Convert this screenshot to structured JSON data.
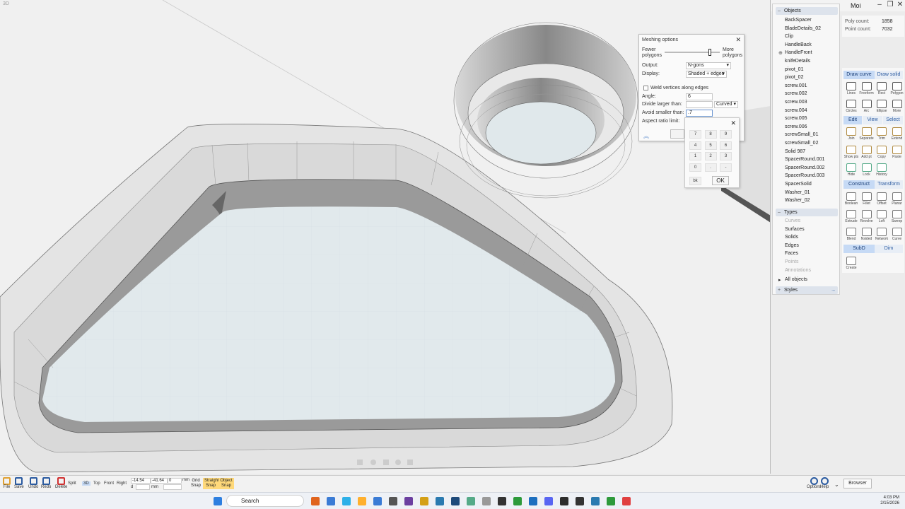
{
  "viewport": {
    "label": "3D"
  },
  "app": {
    "title": "Moi"
  },
  "objects_panel": {
    "header": "Objects",
    "items": [
      "BackSpacer",
      "BladeDetails_02",
      "Clip",
      "HandleBack",
      "HandleFront",
      "knifeDetails",
      "pivot_01",
      "pivot_02",
      "screw.001",
      "screw.002",
      "screw.003",
      "screw.004",
      "screw.005",
      "screw.006",
      "screwSmall_01",
      "screwSmall_02",
      "Solid 987",
      "SpacerRound.001",
      "SpacerRound.002",
      "SpacerRound.003",
      "SpacerSolid",
      "Washer_01",
      "Washer_02"
    ],
    "types_header": "Types",
    "types": [
      {
        "label": "Curves",
        "dim": true
      },
      {
        "label": "Surfaces",
        "dim": false
      },
      {
        "label": "Solids",
        "dim": false
      },
      {
        "label": "Edges",
        "dim": false
      },
      {
        "label": "Faces",
        "dim": false
      },
      {
        "label": "Points",
        "dim": true
      },
      {
        "label": "Annotations",
        "dim": true
      }
    ],
    "all_objects": "All objects",
    "styles": "Styles"
  },
  "info": {
    "poly_label": "Poly count:",
    "poly_value": "1858",
    "point_label": "Point count:",
    "point_value": "7032"
  },
  "tools": {
    "draw_curve": "Draw curve",
    "draw_solid": "Draw solid",
    "row1": [
      "Lines",
      "Freeform",
      "Rect",
      "Polygon"
    ],
    "row2": [
      "Circles",
      "Arc",
      "Ellipse",
      "More"
    ],
    "edit": "Edit",
    "view": "View",
    "select": "Select",
    "row3": [
      "Join",
      "Separate",
      "Trim",
      "Extend"
    ],
    "row4": [
      "Show pts",
      "Add pt",
      "Copy",
      "Paste"
    ],
    "row5": [
      "Hide",
      "Lock",
      "History"
    ],
    "construct": "Construct",
    "transform": "Transform",
    "row6": [
      "Boolean",
      "Fillet",
      "Offset",
      "Planar"
    ],
    "row7": [
      "Extrude",
      "Revolve",
      "Loft",
      "Sweep"
    ],
    "row8": [
      "Blend",
      "Nsided",
      "Network",
      "Curve"
    ],
    "subd": "SubD",
    "dim": "Dim",
    "row9": [
      "Create"
    ]
  },
  "mesh_dialog": {
    "title": "Meshing options",
    "fewer": "Fewer polygons",
    "more": "More polygons",
    "slider_value": 0.9,
    "output_label": "Output:",
    "output_value": "N-gons",
    "display_label": "Display:",
    "display_value": "Shaded + edges",
    "weld_label": "Weld vertices along edges",
    "angle_label": "Angle:",
    "angle_value": "6",
    "divide_label": "Divide larger than:",
    "divide_mode": "Curved",
    "avoid_label": "Avoid smaller than:",
    "avoid_value": ".7",
    "aspect_label": "Aspect ratio limit:"
  },
  "keypad": {
    "keys": [
      "7",
      "8",
      "9",
      "4",
      "5",
      "6",
      "1",
      "2",
      "3",
      "0",
      ".",
      "-"
    ],
    "bk": "bk",
    "ok": "OK"
  },
  "bottombar": {
    "file": "File",
    "save": "Save",
    "undo": "Undo",
    "redo": "Redo",
    "delete": "Delete",
    "split": "Split",
    "v3d": "3D",
    "top": "Top",
    "front": "Front",
    "right": "Right",
    "x": "-14.54",
    "y": "-41.64",
    "z": "0",
    "unit": "mm",
    "d": "d",
    "mm": "mm",
    "grid_snap": "Grid Snap",
    "straight_snap": "Straight Snap",
    "object_snap": "Object Snap",
    "options": "Options",
    "help": "Help",
    "browser": "Browser"
  },
  "taskbar": {
    "search": "Search",
    "time": "4:03 PM",
    "date": "2/15/2026"
  }
}
